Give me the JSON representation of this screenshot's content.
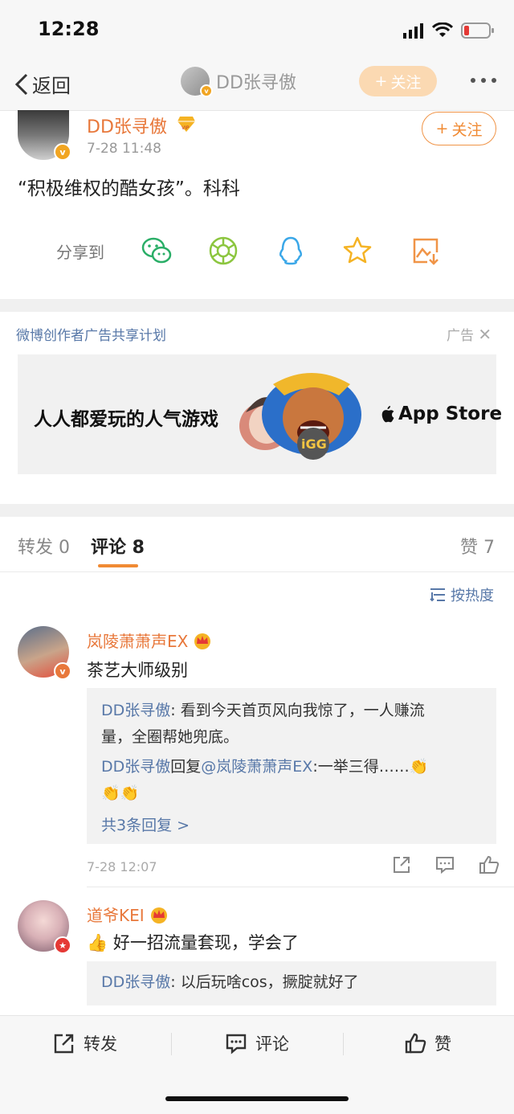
{
  "status": {
    "time": "12:28"
  },
  "nav": {
    "back_label": "返回",
    "title": "DD张寻傲",
    "follow_label": "关注"
  },
  "post": {
    "author": "DD张寻傲",
    "time": "7-28 11:48",
    "follow_label": "关注",
    "text": "“积极维权的酷女孩”。科科",
    "share_label": "分享到"
  },
  "ad": {
    "plan_label": "微博创作者广告共享计划",
    "ad_label": "广告",
    "title": "人人都爱玩的人气游戏",
    "store_label": "App Store",
    "game_logo": "iGG"
  },
  "tabs": {
    "repost": "转发 0",
    "comment": "评论 8",
    "like": "赞 7",
    "sort_label": "按热度"
  },
  "comments": [
    {
      "name": "岚陵萧萧声EX",
      "text": "茶艺大师级别",
      "replies": [
        {
          "name": "DD张寻傲",
          "text": ": 看到今天首页风向我惊了，一人赚流",
          "text2": "量，全圈帮她兜底。"
        },
        {
          "name": "DD张寻傲",
          "mid": "回复",
          "mention": "@岚陵萧萧声EX",
          "text": ":一举三得……👏",
          "text2": "👏👏"
        }
      ],
      "more_replies": "共3条回复 >",
      "time": "7-28 12:07"
    },
    {
      "name": "道爷KEI",
      "text": "👍 好一招流量套现，学会了",
      "replies": [
        {
          "name": "DD张寻傲",
          "text": ": 以后玩啥cos，撅腚就好了"
        }
      ]
    }
  ],
  "toolbar": {
    "repost": "转发",
    "comment": "评论",
    "like": "赞"
  },
  "colors": {
    "accent": "#f08a33",
    "link": "#5878a8",
    "name": "#e8783b"
  }
}
